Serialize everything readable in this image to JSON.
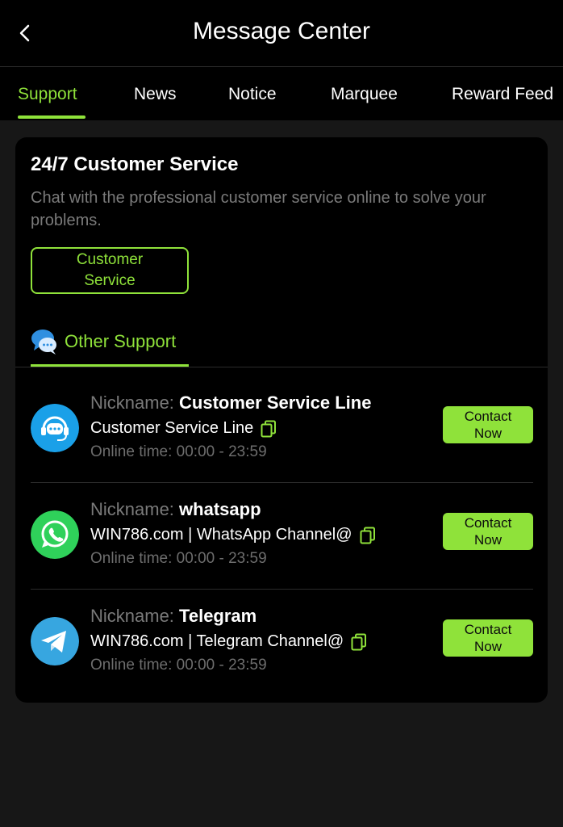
{
  "header": {
    "title": "Message Center",
    "back_icon": "chevron-left-icon"
  },
  "tabs": [
    {
      "label": "Support",
      "active": true
    },
    {
      "label": "News",
      "active": false
    },
    {
      "label": "Notice",
      "active": false
    },
    {
      "label": "Marquee",
      "active": false
    },
    {
      "label": "Reward Feed",
      "active": false
    }
  ],
  "customer_service": {
    "title": "24/7 Customer Service",
    "description": "Chat with the professional customer service online to solve your problems.",
    "button_label": "Customer Service"
  },
  "other_support": {
    "label": "Other Support",
    "icon": "chat-bubbles-icon",
    "items": [
      {
        "nickname_prefix": "Nickname: ",
        "nickname": "Customer Service Line",
        "account": "Customer Service Line",
        "online_time": "Online time: 00:00 - 23:59",
        "button_label": "Contact Now",
        "icon": "headset-icon"
      },
      {
        "nickname_prefix": "Nickname: ",
        "nickname": "whatsapp",
        "account": "WIN786.com | WhatsApp Channel@",
        "online_time": "Online time: 00:00 - 23:59",
        "button_label": "Contact Now",
        "icon": "whatsapp-icon"
      },
      {
        "nickname_prefix": "Nickname: ",
        "nickname": "Telegram",
        "account": "WIN786.com | Telegram Channel@",
        "online_time": "Online time: 00:00 - 23:59",
        "button_label": "Contact Now",
        "icon": "telegram-icon"
      }
    ]
  },
  "colors": {
    "accent": "#8fe23a",
    "background": "#171717",
    "card": "#000000",
    "muted_text": "#7a7a7a",
    "whatsapp": "#2fd15a",
    "telegram": "#37a6e0",
    "support_blue": "#1aa0e8"
  }
}
